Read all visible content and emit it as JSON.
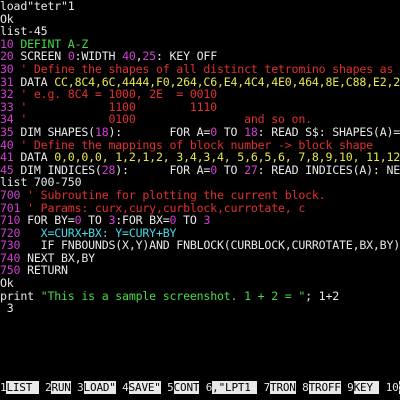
{
  "lines": [
    [
      {
        "t": "load\"tetr\"1",
        "c": "w"
      }
    ],
    [
      {
        "t": "Ok",
        "c": "w"
      }
    ],
    [
      {
        "t": "list-45",
        "c": "w"
      }
    ],
    [
      {
        "t": "10 ",
        "c": "m"
      },
      {
        "t": "DEFINT A-Z",
        "c": "g"
      }
    ],
    [
      {
        "t": "20 ",
        "c": "m"
      },
      {
        "t": "SCREEN ",
        "c": "w"
      },
      {
        "t": "0",
        "c": "m"
      },
      {
        "t": ":WIDTH ",
        "c": "w"
      },
      {
        "t": "40",
        "c": "m"
      },
      {
        "t": ",",
        "c": "w"
      },
      {
        "t": "25",
        "c": "m"
      },
      {
        "t": ": KEY OFF",
        "c": "w"
      }
    ],
    [
      {
        "t": "30 ",
        "c": "m"
      },
      {
        "t": "' Define the shapes of all distinct tetromino shapes as bitmasks.",
        "c": "r"
      }
    ],
    [
      {
        "t": "31 ",
        "c": "m"
      },
      {
        "t": "DATA ",
        "c": "w"
      },
      {
        "t": "CC,8C4,6C,4444,F0,264,C6,E4,4C4,4E0,464,8E,C88,E2,226,2E,88C,E8,622",
        "c": "y"
      }
    ],
    [
      {
        "t": "32 ",
        "c": "m"
      },
      {
        "t": "' e.g. 8C4 = 1000, 2E  = 0010",
        "c": "r"
      }
    ],
    [
      {
        "t": "33 ",
        "c": "m"
      },
      {
        "t": "'            1100        1110",
        "c": "r"
      }
    ],
    [
      {
        "t": "34 ",
        "c": "m"
      },
      {
        "t": "'            0100                and so on.",
        "c": "r"
      }
    ],
    [
      {
        "t": "35 ",
        "c": "m"
      },
      {
        "t": "DIM SHAPES(",
        "c": "w"
      },
      {
        "t": "18",
        "c": "m"
      },
      {
        "t": "):       FOR A=",
        "c": "w"
      },
      {
        "t": "0",
        "c": "m"
      },
      {
        "t": " TO ",
        "c": "w"
      },
      {
        "t": "18",
        "c": "m"
      },
      {
        "t": ": READ S$: SHAPES(A)=VAL(",
        "c": "w"
      },
      {
        "t": "\"&H\"",
        "c": "g"
      },
      {
        "t": "+S$): NEXT",
        "c": "w"
      }
    ],
    [
      {
        "t": "40 ",
        "c": "m"
      },
      {
        "t": "' Define the mappings of block number -> block shape",
        "c": "r"
      }
    ],
    [
      {
        "t": "41 ",
        "c": "m"
      },
      {
        "t": "DATA ",
        "c": "w"
      },
      {
        "t": "0,0,0,0, 1,2,1,2, 3,4,3,4, 5,6,5,6, 7,8,9,10, 11,12,13,14, 15,16,17,18",
        "c": "y"
      }
    ],
    [
      {
        "t": "45 ",
        "c": "m"
      },
      {
        "t": "DIM INDICES(",
        "c": "w"
      },
      {
        "t": "28",
        "c": "m"
      },
      {
        "t": "):      FOR A=",
        "c": "w"
      },
      {
        "t": "0",
        "c": "m"
      },
      {
        "t": " TO ",
        "c": "w"
      },
      {
        "t": "27",
        "c": "m"
      },
      {
        "t": ": READ INDICES(A): NEXT",
        "c": "w"
      }
    ],
    [
      {
        "t": "list 700-750",
        "c": "w"
      }
    ],
    [
      {
        "t": "700 ",
        "c": "m"
      },
      {
        "t": "' Subroutine for plotting the current block.",
        "c": "r"
      }
    ],
    [
      {
        "t": "701 ",
        "c": "m"
      },
      {
        "t": "' Params: curx,cury,curblock,currotate, c",
        "c": "r"
      }
    ],
    [
      {
        "t": "710 ",
        "c": "m"
      },
      {
        "t": "FOR BY=",
        "c": "w"
      },
      {
        "t": "0",
        "c": "m"
      },
      {
        "t": " TO ",
        "c": "w"
      },
      {
        "t": "3",
        "c": "m"
      },
      {
        "t": ":FOR BX=",
        "c": "w"
      },
      {
        "t": "0",
        "c": "m"
      },
      {
        "t": " TO ",
        "c": "w"
      },
      {
        "t": "3",
        "c": "m"
      }
    ],
    [
      {
        "t": "720 ",
        "c": "m"
      },
      {
        "t": "  X=CURX+BX: Y=CURY+BY",
        "c": "c"
      }
    ],
    [
      {
        "t": "730 ",
        "c": "m"
      },
      {
        "t": "  IF FNBOUNDS(X,Y)AND FNBLOCK(CURBLOCK,CURROTATE,BX,BY) THEN GOSUB ",
        "c": "w"
      },
      {
        "t": "900",
        "c": "m"
      }
    ],
    [
      {
        "t": "740 ",
        "c": "m"
      },
      {
        "t": "NEXT BX,BY",
        "c": "w"
      }
    ],
    [
      {
        "t": "750 ",
        "c": "m"
      },
      {
        "t": "RETURN",
        "c": "w"
      }
    ],
    [
      {
        "t": "Ok",
        "c": "w"
      }
    ],
    [
      {
        "t": "print ",
        "c": "w"
      },
      {
        "t": "\"This is a sample screenshot. 1 + 2 = \"",
        "c": "g"
      },
      {
        "t": "; 1+2",
        "c": "w"
      }
    ],
    [
      {
        "t": " 3",
        "c": "w"
      }
    ]
  ],
  "softkeys": [
    {
      "num": "1",
      "label": "LIST "
    },
    {
      "num": "2",
      "label": "RUN"
    },
    {
      "num": "3",
      "label": "LOAD\""
    },
    {
      "num": "4",
      "label": "SAVE\""
    },
    {
      "num": "5",
      "label": "CONT"
    },
    {
      "num": "6",
      "label": ",\"LPT1 "
    },
    {
      "num": "7",
      "label": "TRON"
    },
    {
      "num": "8",
      "label": "TROFF"
    },
    {
      "num": "9",
      "label": "KEY "
    },
    {
      "num": "10",
      "label": "SCREE"
    }
  ]
}
